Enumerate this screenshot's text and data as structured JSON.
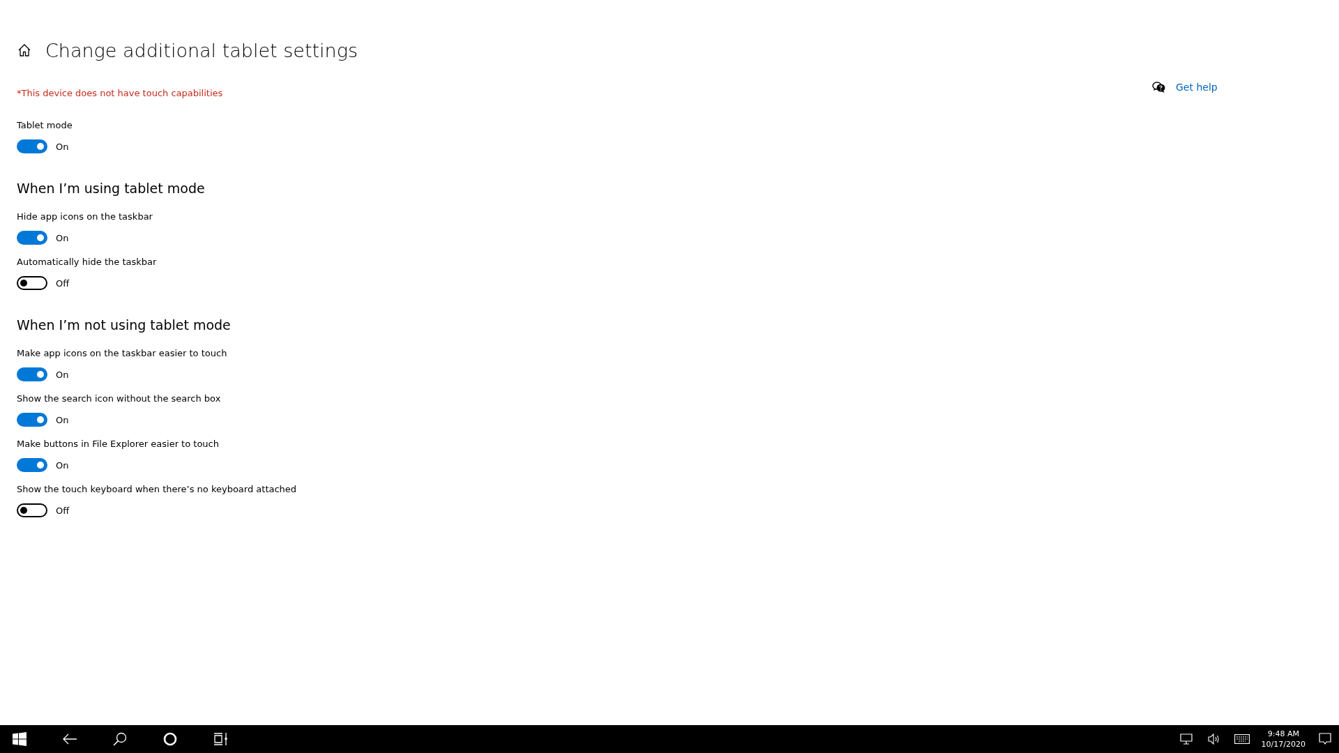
{
  "page": {
    "title": "Change additional tablet settings",
    "notice": "*This device does not have touch capabilities"
  },
  "help": {
    "label": "Get help"
  },
  "sections": [
    {
      "items": [
        {
          "label": "Tablet mode",
          "on": true,
          "state_text": "On"
        }
      ]
    },
    {
      "heading": "When I’m using tablet mode",
      "items": [
        {
          "label": "Hide app icons on the taskbar",
          "on": true,
          "state_text": "On"
        },
        {
          "label": "Automatically hide the taskbar",
          "on": false,
          "state_text": "Off"
        }
      ]
    },
    {
      "heading": "When I’m not using tablet mode",
      "items": [
        {
          "label": "Make app icons on the taskbar easier to touch",
          "on": true,
          "state_text": "On"
        },
        {
          "label": "Show the search icon without the search box",
          "on": true,
          "state_text": "On"
        },
        {
          "label": "Make buttons in File Explorer easier to touch",
          "on": true,
          "state_text": "On"
        },
        {
          "label": "Show the touch keyboard when there’s no keyboard attached",
          "on": false,
          "state_text": "Off"
        }
      ]
    }
  ],
  "taskbar": {
    "buttons": [
      {
        "kind": "start"
      },
      {
        "kind": "back"
      },
      {
        "kind": "search"
      },
      {
        "kind": "cortana"
      },
      {
        "kind": "taskview"
      }
    ],
    "tray": [
      {
        "kind": "network"
      },
      {
        "kind": "volume"
      },
      {
        "kind": "keyboard"
      }
    ],
    "clock": {
      "time": "9:48 AM",
      "date": "10/17/2020"
    }
  }
}
